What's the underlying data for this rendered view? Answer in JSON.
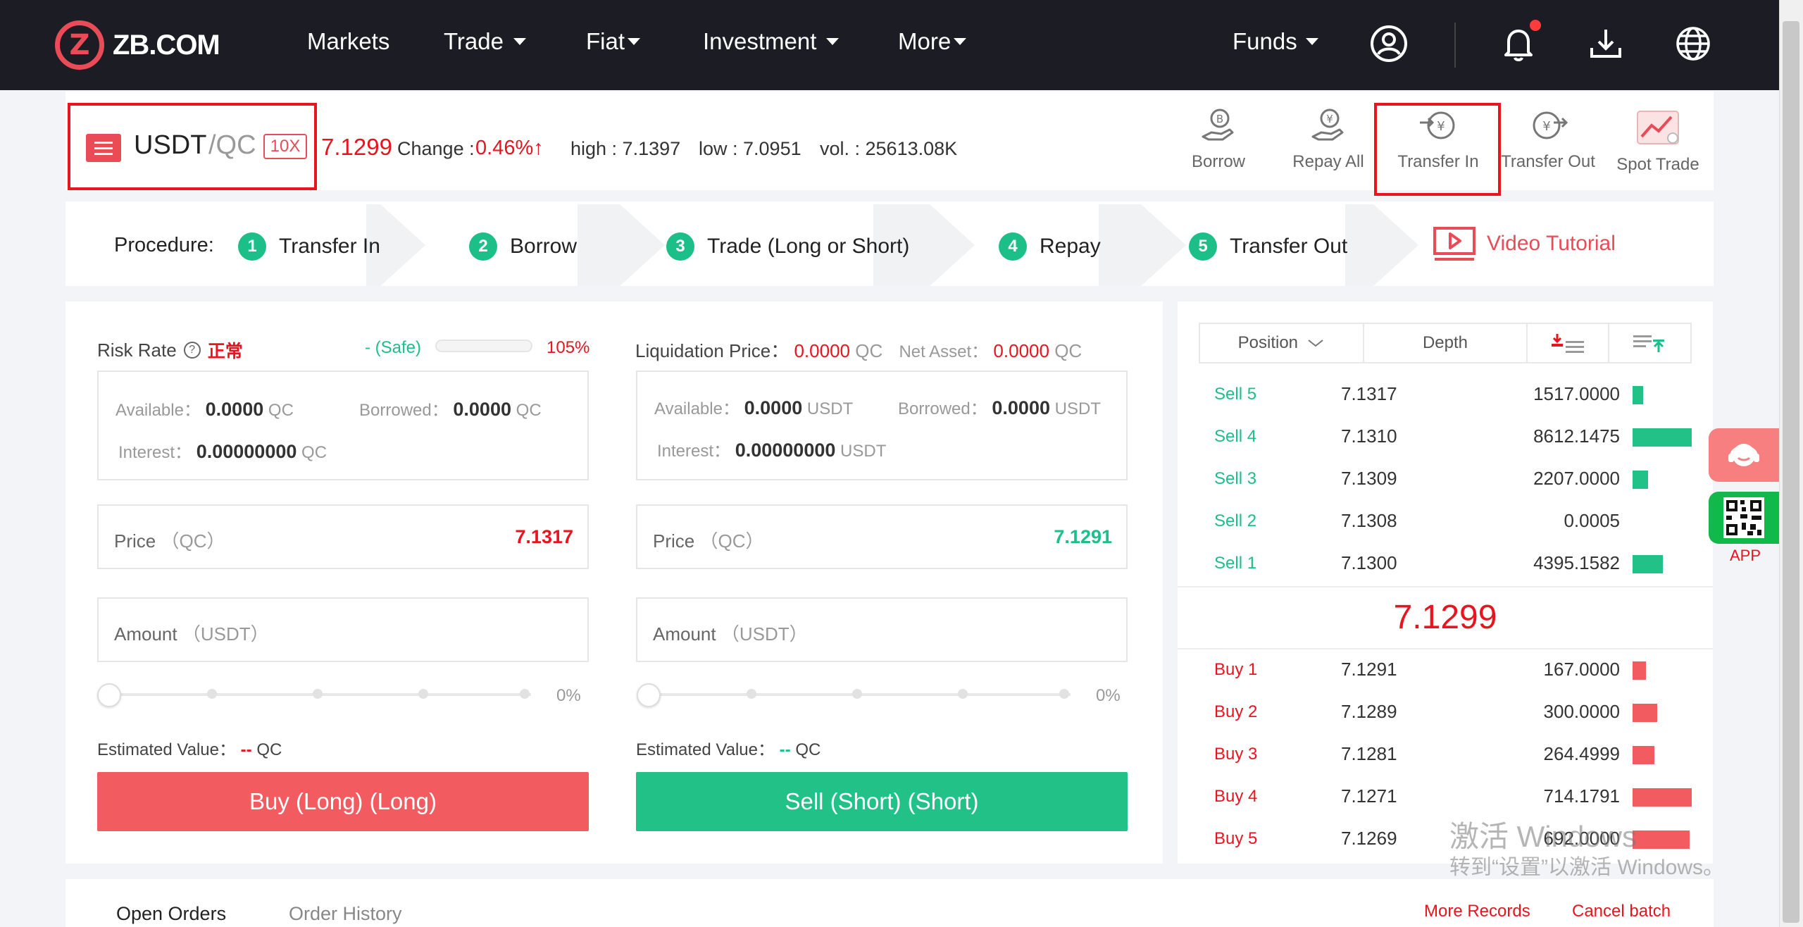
{
  "nav": {
    "logo_text": "ZB.COM",
    "items": [
      "Markets",
      "Trade",
      "Fiat",
      "Investment",
      "More"
    ],
    "funds": "Funds"
  },
  "ticker": {
    "base": "USDT",
    "quote": "/QC",
    "leverage": "10X",
    "price": "7.1299",
    "change_label": "Change :",
    "change": "0.46%↑",
    "high": "high : 7.1397",
    "low": "low : 7.0951",
    "vol": "vol. : 25613.08K"
  },
  "tools": [
    "Borrow",
    "Repay All",
    "Transfer In",
    "Transfer Out",
    "Spot Trade"
  ],
  "procedure": {
    "label": "Procedure:",
    "steps": [
      {
        "num": "1",
        "label": "Transfer In"
      },
      {
        "num": "2",
        "label": "Borrow"
      },
      {
        "num": "3",
        "label": "Trade (Long or Short)"
      },
      {
        "num": "4",
        "label": "Repay"
      },
      {
        "num": "5",
        "label": "Transfer Out"
      }
    ],
    "video": "Video Tutorial"
  },
  "buy_panel": {
    "risk_label": "Risk Rate",
    "risk_status": "正常",
    "risk_safe": "- (Safe)",
    "risk_pct": "105%",
    "available_label": "Available：",
    "available": "0.0000",
    "available_unit": "QC",
    "borrowed_label": "Borrowed：",
    "borrowed": "0.0000",
    "borrowed_unit": "QC",
    "interest_label": "Interest：",
    "interest": "0.00000000",
    "interest_unit": "QC",
    "price_label": "Price",
    "price_unit": "（QC）",
    "price_value": "7.1317",
    "amount_label": "Amount",
    "amount_unit": "（USDT）",
    "slider_pct": "0%",
    "est_label": "Estimated Value：",
    "est_value": "--",
    "est_unit": "QC",
    "button": "Buy (Long) (Long)"
  },
  "sell_panel": {
    "liq_label": "Liquidation Price：",
    "liq_value": "0.0000",
    "liq_unit": "QC",
    "net_label": "Net Asset：",
    "net_value": "0.0000",
    "net_unit": "QC",
    "available_label": "Available：",
    "available": "0.0000",
    "available_unit": "USDT",
    "borrowed_label": "Borrowed：",
    "borrowed": "0.0000",
    "borrowed_unit": "USDT",
    "interest_label": "Interest：",
    "interest": "0.00000000",
    "interest_unit": "USDT",
    "price_label": "Price",
    "price_unit": "（QC）",
    "price_value": "7.1291",
    "amount_label": "Amount",
    "amount_unit": "（USDT）",
    "slider_pct": "0%",
    "est_label": "Estimated Value：",
    "est_value": "--",
    "est_unit": "QC",
    "button": "Sell (Short) (Short)"
  },
  "book": {
    "tab_position": "Position",
    "tab_depth": "Depth",
    "mid_price": "7.1299",
    "sells": [
      {
        "side": "Sell 5",
        "price": "7.1317",
        "qty": "1517.0000",
        "depth": 0.18
      },
      {
        "side": "Sell 4",
        "price": "7.1310",
        "qty": "8612.1475",
        "depth": 1.0
      },
      {
        "side": "Sell 3",
        "price": "7.1309",
        "qty": "2207.0000",
        "depth": 0.26
      },
      {
        "side": "Sell 2",
        "price": "7.1308",
        "qty": "0.0005",
        "depth": 0.0
      },
      {
        "side": "Sell 1",
        "price": "7.1300",
        "qty": "4395.1582",
        "depth": 0.51
      }
    ],
    "buys": [
      {
        "side": "Buy 1",
        "price": "7.1291",
        "qty": "167.0000",
        "depth": 0.23
      },
      {
        "side": "Buy 2",
        "price": "7.1289",
        "qty": "300.0000",
        "depth": 0.42
      },
      {
        "side": "Buy 3",
        "price": "7.1281",
        "qty": "264.4999",
        "depth": 0.37
      },
      {
        "side": "Buy 4",
        "price": "7.1271",
        "qty": "714.1791",
        "depth": 1.0
      },
      {
        "side": "Buy 5",
        "price": "7.1269",
        "qty": "692.0000",
        "depth": 0.97
      }
    ]
  },
  "side": {
    "app": "APP"
  },
  "orders": {
    "open": "Open Orders",
    "history": "Order History",
    "more": "More Records",
    "cancel": "Cancel batch"
  },
  "watermark": {
    "line1": "激活 Windows",
    "line2": "转到“设置”以激活 Windows。"
  },
  "colors": {
    "red": "#e8141e",
    "green": "#1dbf88",
    "nav_bg": "#1b1c24"
  }
}
